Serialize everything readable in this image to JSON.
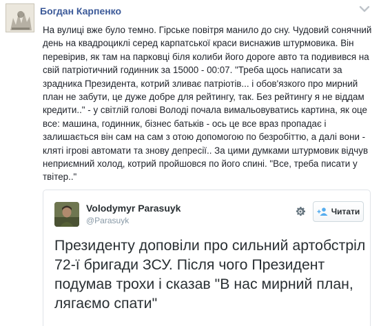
{
  "post": {
    "author": "Богдан Карпенко",
    "body": "На вулиці вже було темно. Гірське повітря манило до сну. Чудовий сонячний день на квадроциклі серед карпатської краси виснажив штурмовика. Він перевірив, як там на парковці біля колиби його дороге авто та подивився на свій патріотичний годинник за 15000 - 00:07. \"Треба щось написати за зрадника Президента, котрий зливає патріотів... і обов'язкого про мирний план не забути, це дуже добре для рейтингу, так. Без рейтингу я не віддам кредити..\" - у світлій голові Володі почала вимальовуватись картина, як оце все: машина, годинник, бізнес батьків - ось це все враз пропадає і залишається він сам на сам з отою допомогою по безробіттю, а далі вони - кляті ігрові автомати та знову депресії.. За цими думками штурмовик відчув неприємний холод, котрий пройшовся по його спині. \"Все, треба писати у твітер..\""
  },
  "tweet": {
    "name": "Volodymyr Parasuyk",
    "handle": "@Parasuyk",
    "follow_label": "Читати",
    "text": "Президенту доповіли про сильний артобстріл 72-ї бригади ЗСУ. Після чого Президент подумав трохи і сказав \"В нас мирний план, лягаємо спати\""
  },
  "colors": {
    "author_link": "#3b5998",
    "twitter_blue": "#55acee",
    "handle_gray": "#8899a6"
  },
  "icons": [
    "profile-avatar",
    "chevron-down-icon",
    "twitter-avatar",
    "gear-icon",
    "follow-user-icon"
  ]
}
